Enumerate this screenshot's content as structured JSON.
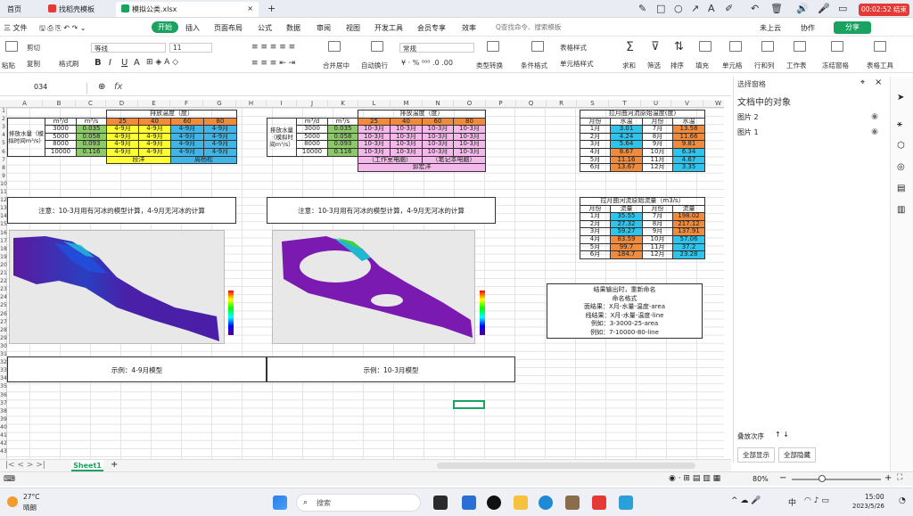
{
  "titlebar": {
    "tab_home": "首页",
    "tab_template": "找稻壳模板",
    "tab_file": "模拟公类.xlsx",
    "add": "+",
    "record_time": "00:02:52 结束"
  },
  "menubar": {
    "file": "三 文件",
    "items": [
      "开始",
      "插入",
      "页面布局",
      "公式",
      "数据",
      "审阅",
      "视图",
      "开发工具",
      "会员专享",
      "效率"
    ],
    "search": "Q查找命令、搜索模板",
    "cloud": "未上云",
    "collab": "协作",
    "share": "分享"
  },
  "ribbon": {
    "paste": "粘贴",
    "cut": "剪切",
    "copy": "复制",
    "format_painter": "格式刷",
    "font": "等线",
    "font_size": "11",
    "bold": "B",
    "italic": "I",
    "underline": "U",
    "strike": "A",
    "merge": "合并居中",
    "wrap": "自动换行",
    "numfmt": "常规",
    "convert": "类型转换",
    "cond": "条件格式",
    "table_style": "表格样式",
    "cell_style": "单元格样式",
    "sum": "求和",
    "filter": "筛选",
    "sort": "排序",
    "fill": "填充",
    "cells": "单元格",
    "rowcol": "行和列",
    "sheet": "工作表",
    "freeze": "冻结窗格",
    "tools": "表格工具"
  },
  "formulabar": {
    "namebox": "034",
    "fx": "fx"
  },
  "columns": [
    "A",
    "B",
    "C",
    "D",
    "E",
    "F",
    "G",
    "H",
    "I",
    "J",
    "K",
    "L",
    "M",
    "N",
    "O",
    "P",
    "Q",
    "R",
    "S",
    "T",
    "U",
    "V",
    "W"
  ],
  "rows": [
    "1",
    "2",
    "3",
    "4",
    "5",
    "6",
    "7",
    "8",
    "9",
    "10",
    "11",
    "12",
    "13",
    "14",
    "15",
    "16",
    "17",
    "18",
    "19",
    "20",
    "21",
    "22",
    "23",
    "24",
    "25",
    "26",
    "27",
    "28",
    "29",
    "30",
    "31",
    "32",
    "33",
    "34",
    "35",
    "36",
    "37",
    "38",
    "39",
    "40",
    "41",
    "42",
    "43"
  ],
  "table1": {
    "header_main": "排放温度（度）",
    "m3d": "m³/d",
    "m3s": "m³/s",
    "temps": [
      "25",
      "40",
      "60",
      "80"
    ],
    "rowlabel": "排放水量（模拟时间m³/s）",
    "rows": [
      [
        "3000",
        "0.035",
        "4-9月",
        "4-9月",
        "4-9月",
        "4-9月"
      ],
      [
        "5000",
        "0.058",
        "4-9月",
        "4-9月",
        "4-9月",
        "4-9月"
      ],
      [
        "8000",
        "0.093",
        "4-9月",
        "4-9月",
        "4-9月",
        "4-9月"
      ],
      [
        "10000",
        "0.116",
        "4-9月",
        "4-9月",
        "4-9月",
        "4-9月"
      ]
    ],
    "owner1": "段洋",
    "owner2": "周杨松"
  },
  "table2": {
    "header_main": "排放温度（度）",
    "m3d": "m³/d",
    "m3s": "m³/s",
    "temps": [
      "25",
      "40",
      "60",
      "80"
    ],
    "rowlabel": "排放水量（模拟时间m³/s）",
    "rows": [
      [
        "3000",
        "0.035",
        "10-3月",
        "10-3月",
        "10-3月",
        "10-3月"
      ],
      [
        "5000",
        "0.058",
        "10-3月",
        "10-3月",
        "10-3月",
        "10-3月"
      ],
      [
        "8000",
        "0.093",
        "10-3月",
        "10-3月",
        "10-3月",
        "10-3月"
      ],
      [
        "10000",
        "0.116",
        "10-3月",
        "10-3月",
        "10-3月",
        "10-3月"
      ]
    ],
    "note_left": "（工作室电脑）",
    "note_right": "（笔记本电脑）",
    "owner": "郭宏洋"
  },
  "table3": {
    "title": "拉月曲河流原始温度(度)",
    "h_month": "月份",
    "h_temp": "水温",
    "rows": [
      [
        "1月",
        "3.01",
        "7月",
        "13.58"
      ],
      [
        "2月",
        "4.24",
        "8月",
        "11.66"
      ],
      [
        "3月",
        "5.64",
        "9月",
        "9.81"
      ],
      [
        "4月",
        "8.67",
        "10月",
        "6.34"
      ],
      [
        "5月",
        "11.16",
        "11月",
        "4.67"
      ],
      [
        "6月",
        "13.67",
        "12月",
        "3.35"
      ]
    ]
  },
  "table4": {
    "title": "拉月曲河流原始流量（m3/s）",
    "h_month": "月份",
    "h_flow": "流量",
    "rows": [
      [
        "1月",
        "35.55",
        "7月",
        "198.02"
      ],
      [
        "2月",
        "27.32",
        "8月",
        "217.12"
      ],
      [
        "3月",
        "59.27",
        "9月",
        "137.91"
      ],
      [
        "4月",
        "83.59",
        "10月",
        "57.06"
      ],
      [
        "5月",
        "99.7",
        "11月",
        "37.2"
      ],
      [
        "6月",
        "184.7",
        "12月",
        "23.28"
      ]
    ]
  },
  "notes": {
    "left": "注意：10-3月用有河冰的模型计算，4-9月无河冰的计算",
    "right": "注意：10-3月用有河冰的模型计算，4-9月无河冰的计算"
  },
  "rules": {
    "lines": [
      "结果输出时，重新命名",
      "命名格式",
      "面结果：X月-水量-温度-area",
      "线结果：X月-水量-温度-line",
      "例如：3-3000-25-area",
      "例如：7-10000-80-line"
    ]
  },
  "examples": {
    "left": "示例：4-9月模型",
    "right": "示例：10-3月模型"
  },
  "panel": {
    "title": "选择窗格",
    "subtitle": "文档中的对象",
    "items": [
      "图片 2",
      "图片 1"
    ],
    "order": "叠放次序",
    "show_all": "全部显示",
    "hide_all": "全部隐藏"
  },
  "sheettabs": {
    "sheet1": "Sheet1",
    "add": "+"
  },
  "statusbar": {
    "zoom": "80%"
  },
  "taskbar": {
    "temp": "27°C",
    "weather": "晴朗",
    "search": "搜索",
    "ime": "中",
    "time": "15:00",
    "date": "2023/5/26"
  },
  "colors": {
    "accent": "#1aa260",
    "orange": "#f08a3c",
    "green": "#8dc86a",
    "yellow": "#ffff33",
    "blue": "#41b6e6",
    "pink": "#f4b8ea"
  }
}
